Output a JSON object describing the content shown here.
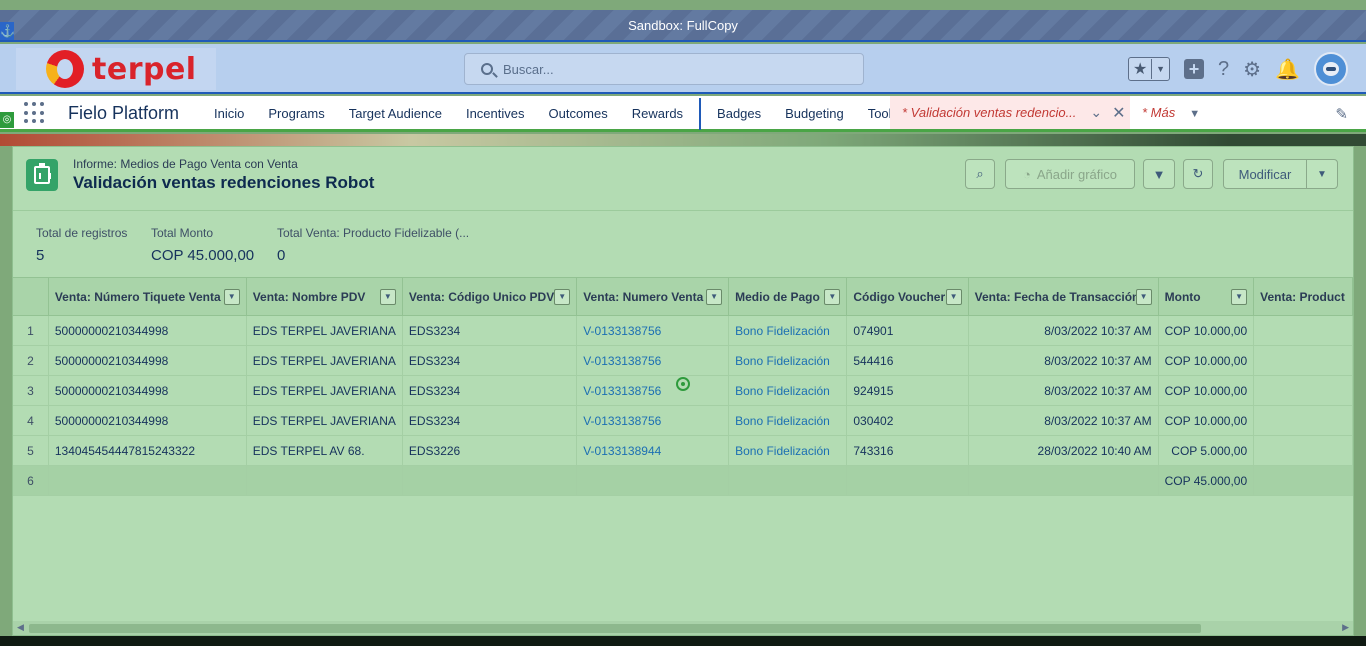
{
  "sandbox": {
    "label": "Sandbox: FullCopy"
  },
  "header": {
    "logo_text": "terpel",
    "search_placeholder": "Buscar...",
    "icons": [
      "favorites-star-icon",
      "add-icon",
      "help-icon",
      "setup-gear-icon",
      "notifications-bell-icon",
      "user-avatar"
    ]
  },
  "nav": {
    "app_name": "Fielo Platform",
    "items": [
      "Inicio",
      "Programs",
      "Target Audience",
      "Incentives",
      "Outcomes",
      "Rewards",
      "Badges",
      "Budgeting",
      "Tools"
    ],
    "active_tab": "* Validación ventas redencio...",
    "more": "* Más"
  },
  "report": {
    "eyebrow": "Informe: Medios de Pago Venta con Venta",
    "title": "Validación ventas redenciones Robot",
    "buttons": {
      "add_chart": "Añadir gráfico",
      "modify": "Modificar"
    }
  },
  "summary": [
    {
      "label": "Total de registros",
      "value": "5"
    },
    {
      "label": "Total Monto",
      "value": "COP 45.000,00"
    },
    {
      "label": "Total Venta: Producto Fidelizable (...",
      "value": "0"
    }
  ],
  "table": {
    "columns": [
      "Venta: Número Tiquete Venta",
      "Venta: Nombre PDV",
      "Venta: Código Unico PDV",
      "Venta: Numero Venta",
      "Medio de Pago",
      "Código Voucher",
      "Venta: Fecha de Transacción",
      "Monto",
      "Venta: Product"
    ],
    "rows": [
      {
        "n": "1",
        "tiquete": "50000000210344998",
        "pdv": "EDS TERPEL JAVERIANA",
        "codigo": "EDS3234",
        "venta": "V-0133138756",
        "medio": "Bono Fidelización",
        "voucher": "074901",
        "fecha": "8/03/2022 10:37 AM",
        "monto": "COP 10.000,00"
      },
      {
        "n": "2",
        "tiquete": "50000000210344998",
        "pdv": "EDS TERPEL JAVERIANA",
        "codigo": "EDS3234",
        "venta": "V-0133138756",
        "medio": "Bono Fidelización",
        "voucher": "544416",
        "fecha": "8/03/2022 10:37 AM",
        "monto": "COP 10.000,00"
      },
      {
        "n": "3",
        "tiquete": "50000000210344998",
        "pdv": "EDS TERPEL JAVERIANA",
        "codigo": "EDS3234",
        "venta": "V-0133138756",
        "medio": "Bono Fidelización",
        "voucher": "924915",
        "fecha": "8/03/2022 10:37 AM",
        "monto": "COP 10.000,00"
      },
      {
        "n": "4",
        "tiquete": "50000000210344998",
        "pdv": "EDS TERPEL JAVERIANA",
        "codigo": "EDS3234",
        "venta": "V-0133138756",
        "medio": "Bono Fidelización",
        "voucher": "030402",
        "fecha": "8/03/2022 10:37 AM",
        "monto": "COP 10.000,00"
      },
      {
        "n": "5",
        "tiquete": "134045454447815243322",
        "pdv": "EDS TERPEL AV 68.",
        "codigo": "EDS3226",
        "venta": "V-0133138944",
        "medio": "Bono Fidelización",
        "voucher": "743316",
        "fecha": "28/03/2022 10:40 AM",
        "monto": "COP 5.000,00"
      }
    ],
    "total_row": {
      "n": "6",
      "monto": "COP 45.000,00"
    }
  }
}
